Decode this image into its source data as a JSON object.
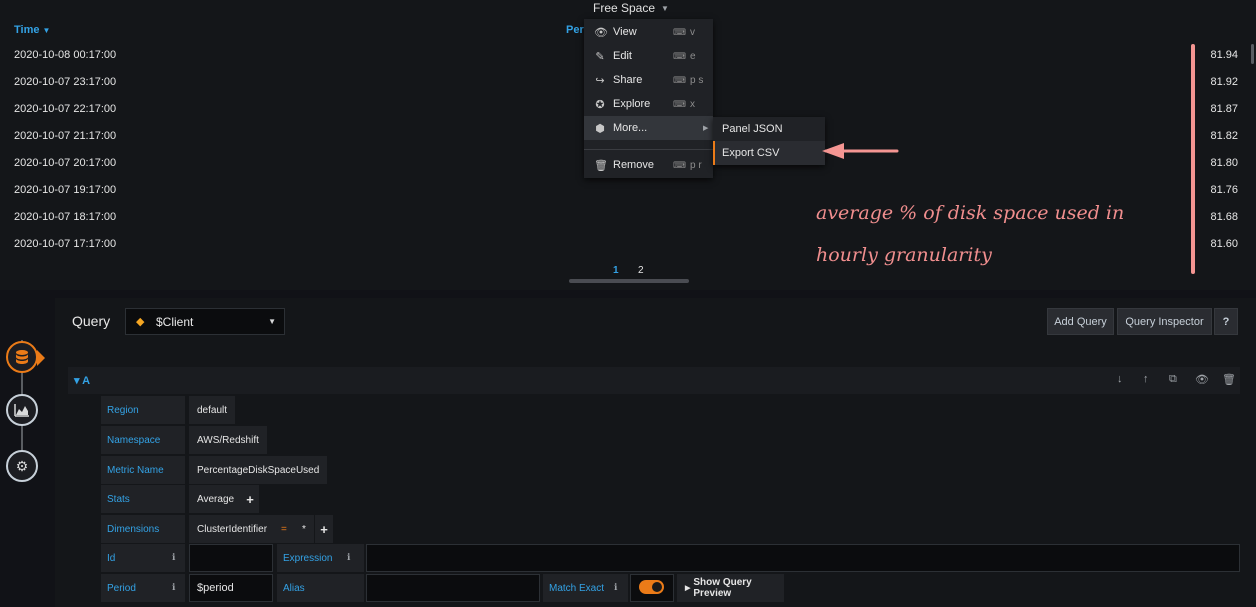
{
  "panel": {
    "title": "Free Space",
    "columns": {
      "time": "Time",
      "percent_partial": "Per"
    },
    "rows": [
      {
        "time": "2020-10-08 00:17:00",
        "value": "81.94"
      },
      {
        "time": "2020-10-07 23:17:00",
        "value": "81.92"
      },
      {
        "time": "2020-10-07 22:17:00",
        "value": "81.87"
      },
      {
        "time": "2020-10-07 21:17:00",
        "value": "81.82"
      },
      {
        "time": "2020-10-07 20:17:00",
        "value": "81.80"
      },
      {
        "time": "2020-10-07 19:17:00",
        "value": "81.76"
      },
      {
        "time": "2020-10-07 18:17:00",
        "value": "81.68"
      },
      {
        "time": "2020-10-07 17:17:00",
        "value": "81.60"
      }
    ],
    "pages": [
      "1",
      "2"
    ]
  },
  "menu": {
    "items": [
      {
        "label": "View",
        "shortcut": "v",
        "icon": "eye-icon"
      },
      {
        "label": "Edit",
        "shortcut": "e",
        "icon": "edit-icon"
      },
      {
        "label": "Share",
        "shortcut": "p s",
        "icon": "share-icon"
      },
      {
        "label": "Explore",
        "shortcut": "x",
        "icon": "compass-icon"
      },
      {
        "label": "More...",
        "shortcut": "",
        "icon": "cube-icon"
      },
      {
        "label": "Remove",
        "shortcut": "p r",
        "icon": "trash-icon"
      }
    ],
    "submenu": [
      "Panel JSON",
      "Export CSV"
    ]
  },
  "annotation": {
    "line1": "average % of disk space used in",
    "line2": "hourly granularity"
  },
  "query": {
    "label": "Query",
    "datasource": "$Client",
    "add_query": "Add Query",
    "inspector": "Query Inspector",
    "help": "?",
    "ref_id": "A",
    "fields": {
      "region_label": "Region",
      "region": "default",
      "namespace_label": "Namespace",
      "namespace": "AWS/Redshift",
      "metric_label": "Metric Name",
      "metric": "PercentageDiskSpaceUsed",
      "stats_label": "Stats",
      "stats": "Average",
      "dimensions_label": "Dimensions",
      "dim_key": "ClusterIdentifier",
      "dim_op": "=",
      "dim_val": "*",
      "id_label": "Id",
      "id": "",
      "expression_label": "Expression",
      "expression": "",
      "period_label": "Period",
      "period": "$period",
      "alias_label": "Alias",
      "alias": "",
      "match_exact_label": "Match Exact",
      "preview": "Show Query Preview"
    }
  },
  "colors": {
    "accent": "#eb7b18",
    "link": "#33a2e5",
    "annotation": "#f08e8e"
  }
}
